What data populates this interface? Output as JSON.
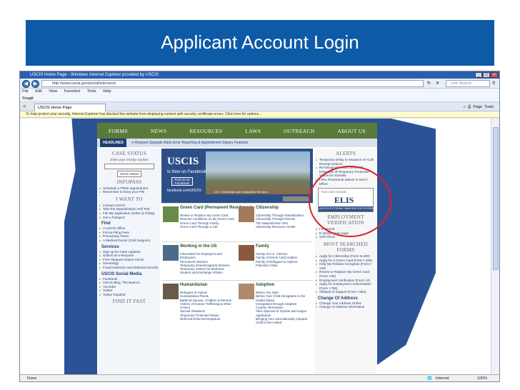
{
  "slide": {
    "title": "Applicant Account Login"
  },
  "browser": {
    "window_title": "USCIS Home Page - Windows Internet Explorer provided by USCIS",
    "url": "http://www.uscis.gov/portal/site/uscis",
    "search_placeholder": "Live Search",
    "menu": [
      "File",
      "Edit",
      "View",
      "Favorites",
      "Tools",
      "Help"
    ],
    "links_label": "Snagit",
    "tab_label": "USCIS Home Page",
    "tools": [
      "Page",
      "Tools"
    ],
    "info_bar": "To help protect your security, Internet Explorer has blocked this website from displaying content with security certificate errors. Click here for options...",
    "status_left": "Done",
    "status_zone": "Internet",
    "zoom": "100%"
  },
  "site": {
    "nav": [
      "FORMS",
      "NEWS",
      "RESOURCES",
      "LAWS",
      "OUTREACH",
      "ABOUT US"
    ],
    "headlines_label": "HEADLINES",
    "headlines_text": "e-Request Upgrade Adds Error Reporting & Appointment Inquiry Features",
    "case_status": {
      "title": "CASE STATUS",
      "prompt": "Enter your receipt number",
      "button": "Check Status"
    },
    "infopass": {
      "title": "INFOPASS",
      "items": [
        "Schedule a FREE appointment",
        "Remember to keep your PIN"
      ]
    },
    "i_want_to": {
      "title": "I WANT TO",
      "items": [
        "Contact USCIS",
        "Take the Naturalization Self Test",
        "File My Application Online (e-Filing)",
        "Get a Passport"
      ]
    },
    "find": {
      "title": "Find",
      "items": [
        "A USCIS Office",
        "Forms Filing Fees",
        "Processing Times",
        "A Medical Doctor (Civil Surgeon)"
      ]
    },
    "services": {
      "title": "Services",
      "items": [
        "Sign up for Case Updates",
        "Submit an e-Request",
        "FOIA Request Status Check",
        "Genealogy",
        "Fraud Detection and National Security"
      ]
    },
    "social": {
      "title": "USCIS Social Media",
      "items": [
        "Facebook",
        "USCIS Blog, The Beacon",
        "YouTube",
        "Twitter",
        "Twitter Español"
      ]
    },
    "find_it_fast": "FIND IT FAST",
    "banner": {
      "logo": "USCIS",
      "tagline": "Is Now on Facebook",
      "fb_button": "Find us on Facebook",
      "fb_url": "facebook.com/USCIS",
      "agency": "U.S. Citizenship and Immigration Services"
    },
    "green_card": {
      "title": "Green Card (Permanent Residence)",
      "items": [
        "Renew or Replace My Green Card",
        "Remove Conditions on My Green Card",
        "Green Card Through Family",
        "Green Card Through a Job"
      ]
    },
    "citizenship": {
      "title": "Citizenship",
      "items": [
        "Citizenship Through Naturalization",
        "Citizenship Through Parents",
        "The Naturalization Test",
        "Citizenship Resource Center"
      ]
    },
    "working": {
      "title": "Working in the US",
      "items": [
        "Information for Employers and Employees",
        "Permanent Workers",
        "Temporary (Nonimmigrant) Workers",
        "Temporary Visitors for Business",
        "Student and Exchange Visitors"
      ]
    },
    "family": {
      "title": "Family",
      "items": [
        "Family of U.S. Citizens",
        "Family of Green Card Holders",
        "Family of Refugees & Asylees",
        "Fiancé(e) Visas"
      ]
    },
    "humanitarian": {
      "title": "Humanitarian",
      "items": [
        "Refugees & Asylum",
        "Humanitarian Parole",
        "Battered Spouse, Children & Parents",
        "Victims of Human Trafficking & Other Crimes",
        "Special Situations",
        "Temporary Protected Status",
        "Deferred Enforced Departure"
      ]
    },
    "adoption": {
      "title": "Adoption",
      "items": [
        "Before You Start",
        "Before Your Child Immigrates to the United States",
        "Immigration through Adoption",
        "Country Information",
        "After Approval of Orphan and Hague Application",
        "Bringing Your Internationally Adopted Child to the United"
      ]
    },
    "alerts": {
      "title": "ALERTS",
      "items": [
        "Temporary Delay in Issuance of I-129 Receipt Notices",
        "Re-Designation and 18-Month Extension of Temporary Protected Status for Somalia",
        "I-551 Provisional Waiver Is Not in Effect"
      ]
    },
    "elis": {
      "top": "FILE I-539 ONLINE",
      "logo": "ELIS",
      "bottom": "USCIS ELECTRONIC IMMIGRATION SYSTEM"
    },
    "employment": {
      "title": "EMPLOYMENT VERIFICATION",
      "items": [
        "I-9 Central",
        "E-Verify Home page",
        "Self Check"
      ]
    },
    "most_searched": {
      "title": "MOST SEARCHED FORMS",
      "items": [
        "Apply for Citizenship (Form N-400)",
        "Apply for a Green Card (Form I-485)",
        "Help My Relative Immigrate (Form I-130)",
        "Renew or Replace My Green Card (Form I-90)",
        "Employment Verification (Form I-9)",
        "Apply for Employment Authorization (Form I-765)",
        "Affidavit of Support (Form I-864)"
      ]
    },
    "change_address": {
      "title": "Change Of Address",
      "items": [
        "Change Your Address Online",
        "Change of Address Information"
      ]
    }
  }
}
